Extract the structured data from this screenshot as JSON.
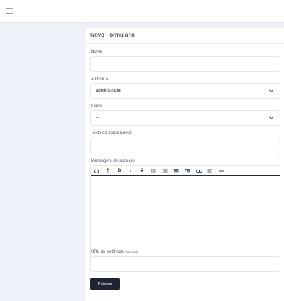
{
  "form": {
    "title": "Novo Formulário",
    "name_label": "Nome",
    "name_value": "",
    "assign_label": "Atribuir a",
    "assign_value": "administrador",
    "source_label": "Fonte",
    "source_value": "--",
    "submit_text_label": "Texto do botão Enviar",
    "submit_text_value": "",
    "success_label": "Mensagem de sucesso",
    "webhook_label": "URL do webhook",
    "webhook_optional": "(opcional)",
    "webhook_value": "",
    "next_button": "Próximo"
  },
  "editor_toolbar": {
    "code_icon": "code-icon",
    "paragraph": "¶",
    "bold": "B",
    "italic": "I",
    "strike": "S",
    "bullet_list_icon": "bullet-list-icon",
    "ordered_list_icon": "ordered-list-icon",
    "outdent_icon": "outdent-icon",
    "indent_icon": "indent-icon",
    "link_icon": "link-icon",
    "align_icon": "align-left-icon",
    "hr_icon": "horizontal-rule-icon"
  }
}
